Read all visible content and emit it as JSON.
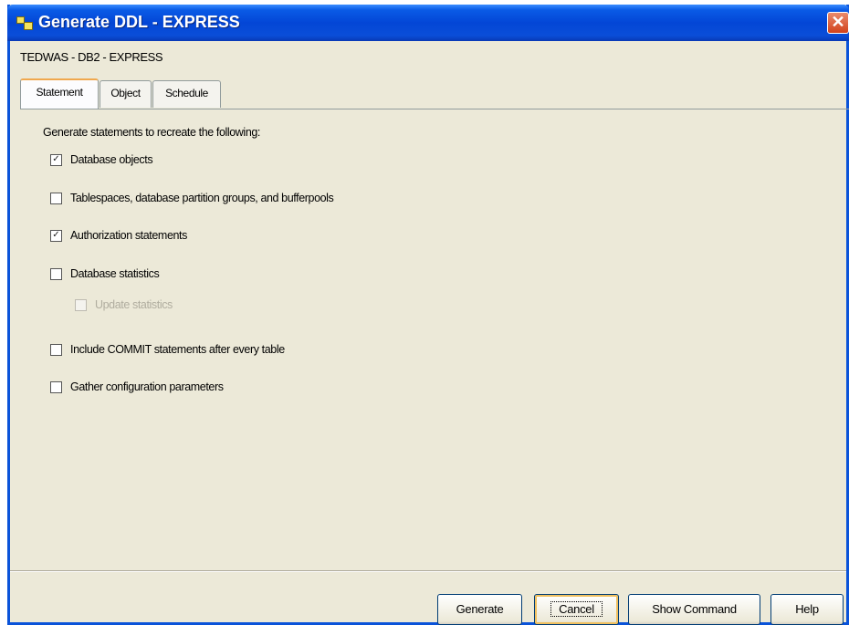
{
  "window": {
    "title": "Generate DDL - EXPRESS",
    "close_glyph": "✕"
  },
  "breadcrumb": "TEDWAS - DB2 - EXPRESS",
  "tabs": [
    {
      "label": "Statement",
      "active": true
    },
    {
      "label": "Object",
      "active": false
    },
    {
      "label": "Schedule",
      "active": false
    }
  ],
  "statement": {
    "intro": "Generate statements to recreate the following:",
    "options": [
      {
        "label": "Database objects",
        "checked": true,
        "enabled": true
      },
      {
        "label": "Tablespaces, database partition groups, and bufferpools",
        "checked": false,
        "enabled": true
      },
      {
        "label": "Authorization statements",
        "checked": true,
        "enabled": true
      },
      {
        "label": "Database statistics",
        "checked": false,
        "enabled": true
      },
      {
        "label": "Update statistics",
        "checked": false,
        "enabled": false
      },
      {
        "label": "Include COMMIT statements after every table",
        "checked": false,
        "enabled": true
      },
      {
        "label": "Gather configuration parameters",
        "checked": false,
        "enabled": true
      }
    ]
  },
  "buttons": {
    "generate": "Generate",
    "cancel": "Cancel",
    "show_command": "Show Command",
    "help": "Help"
  },
  "icons": {
    "app": "generate-ddl-icon",
    "close": "close-icon",
    "check": "checkmark-icon"
  },
  "colors": {
    "titlebar": "#0346d6",
    "close_button": "#d3421b",
    "dialog_background": "#ece9d8",
    "active_tab_accent": "#f0a84e"
  }
}
